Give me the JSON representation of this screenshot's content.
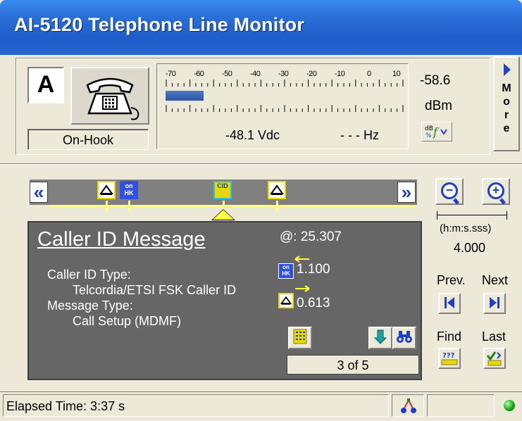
{
  "window": {
    "title": "AI-5120  Telephone Line Monitor"
  },
  "line": {
    "letter": "A",
    "hook_status": "On-Hook"
  },
  "meter": {
    "scale_labels": [
      "-70",
      "-60",
      "-50",
      "-40",
      "-30",
      "-20",
      "-10",
      "0",
      "10"
    ],
    "level_fraction": 0.16,
    "vdc": "-48.1 Vdc",
    "hz": "- - -  Hz",
    "dbm_value": "-58.6",
    "dbm_unit": "dBm",
    "db_button_icon": "db-scale-icon"
  },
  "more_button": {
    "letters": [
      "M",
      "o",
      "r",
      "e"
    ]
  },
  "timeline": {
    "prev_label": "«",
    "next_label": "»",
    "events": [
      {
        "icon": "ring-icon",
        "label": ""
      },
      {
        "icon": "on-hook-icon",
        "label": "on HK"
      },
      {
        "icon": "caller-id-icon",
        "label": "CID"
      },
      {
        "icon": "ring-icon",
        "label": ""
      }
    ]
  },
  "detail": {
    "title": "Caller ID Message",
    "at_time": "@: 25.307",
    "cid_type_label": "Caller ID Type:",
    "cid_type_value": "Telcordia/ETSI FSK Caller ID",
    "msg_type_label": "Message Type:",
    "msg_type_value": "Call Setup (MDMF)",
    "delta_prev": "1.100",
    "delta_next": "0.613",
    "counter": "3 of 5"
  },
  "zoom": {
    "units": "(h:m:s.sss)",
    "scale": "4.000"
  },
  "nav": {
    "prev_label": "Prev.",
    "next_label": "Next",
    "find_label": "Find",
    "last_label": "Last",
    "find_icon_text": "???"
  },
  "status": {
    "elapsed": "Elapsed Time:  3:37 s",
    "indicator_color": "#10A010"
  }
}
